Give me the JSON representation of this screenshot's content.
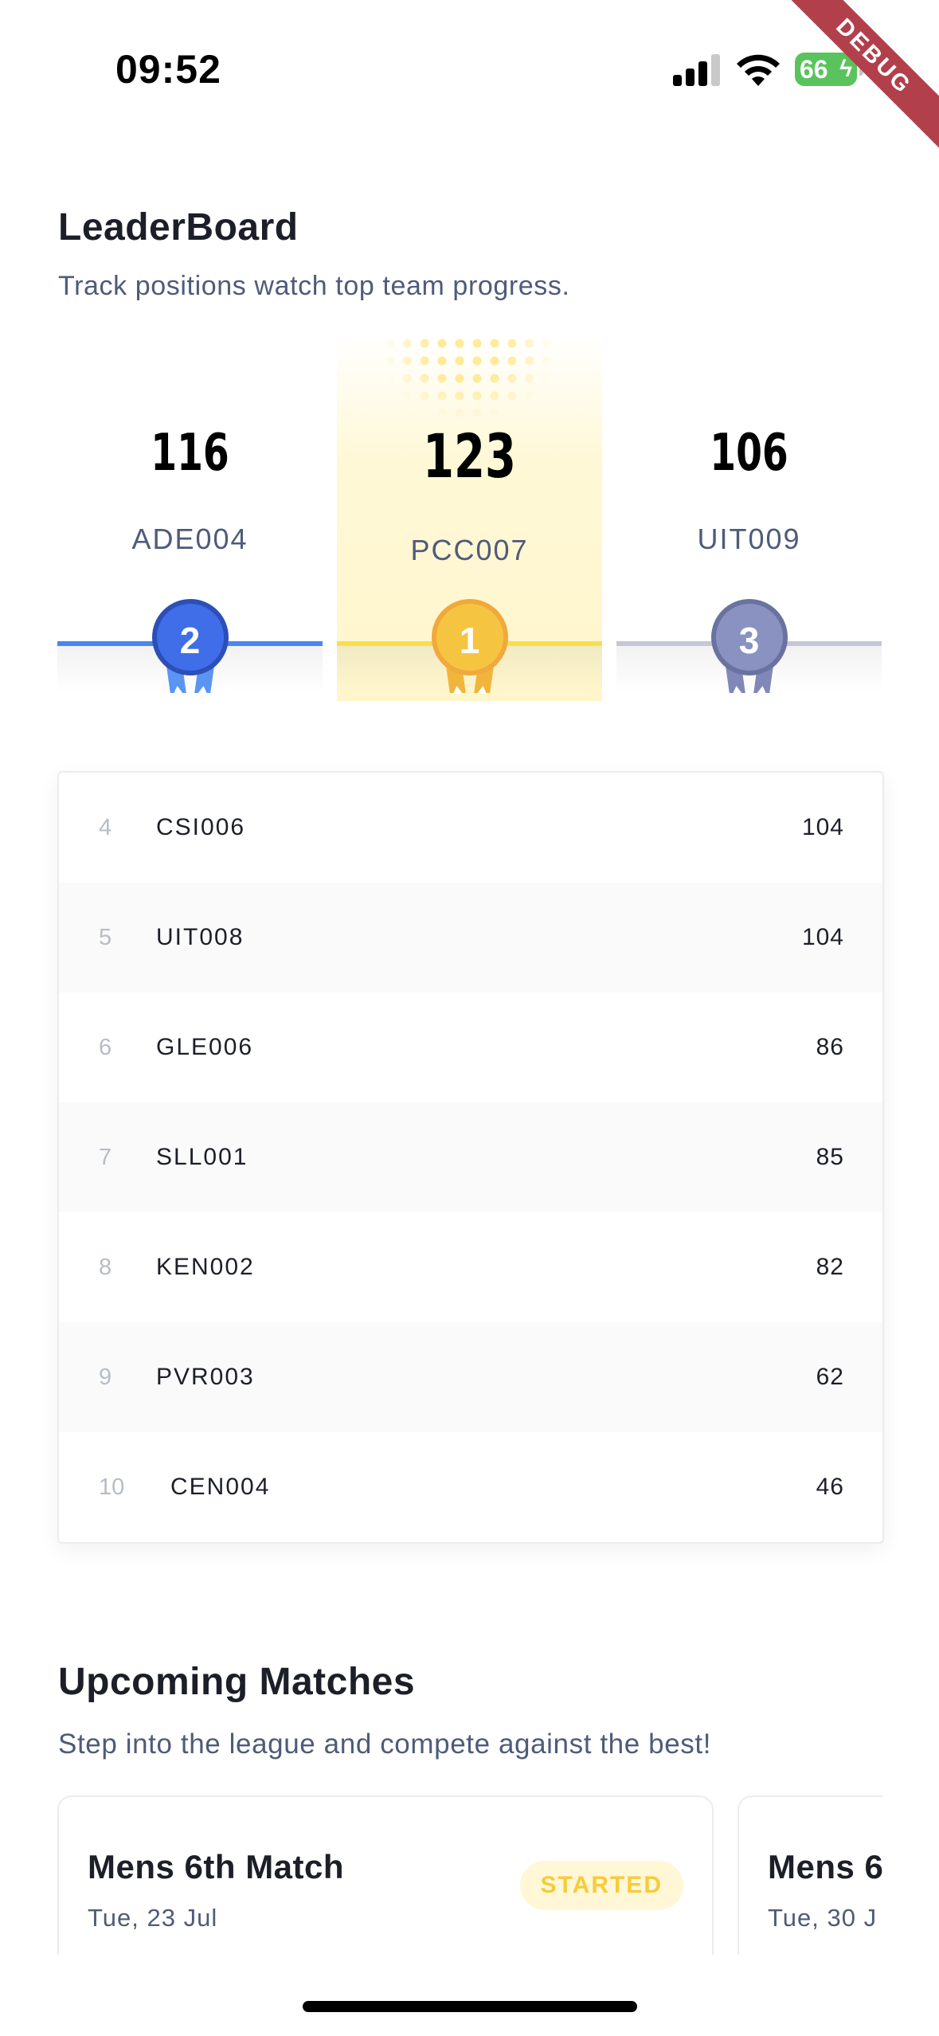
{
  "status_bar": {
    "time": "09:52",
    "battery": "66",
    "debug_label": "DEBUG"
  },
  "leaderboard": {
    "title": "LeaderBoard",
    "subtitle": "Track positions watch top team progress.",
    "podium": [
      {
        "rank": "2",
        "score": "116",
        "team": "ADE004",
        "color": "#3f6ee8"
      },
      {
        "rank": "1",
        "score": "123",
        "team": "PCC007",
        "color": "#f5c542"
      },
      {
        "rank": "3",
        "score": "106",
        "team": "UIT009",
        "color": "#8a92c2"
      }
    ],
    "rows": [
      {
        "rank": "4",
        "team": "CSI006",
        "score": "104"
      },
      {
        "rank": "5",
        "team": "UIT008",
        "score": "104"
      },
      {
        "rank": "6",
        "team": "GLE006",
        "score": "86"
      },
      {
        "rank": "7",
        "team": "SLL001",
        "score": "85"
      },
      {
        "rank": "8",
        "team": "KEN002",
        "score": "82"
      },
      {
        "rank": "9",
        "team": "PVR003",
        "score": "62"
      },
      {
        "rank": "10",
        "team": "CEN004",
        "score": "46"
      }
    ]
  },
  "upcoming": {
    "title": "Upcoming Matches",
    "subtitle": "Step into the league and compete against the best!",
    "matches": [
      {
        "name": "Mens 6th Match",
        "date": "Tue, 23 Jul",
        "status": "STARTED"
      },
      {
        "name": "Mens 6",
        "date": "Tue, 30 J"
      }
    ]
  },
  "colors": {
    "accent_blue": "#3f6ee8",
    "gold": "#f5c542",
    "silver_blue": "#8a92c2",
    "muted_text": "#4e5b7a"
  }
}
